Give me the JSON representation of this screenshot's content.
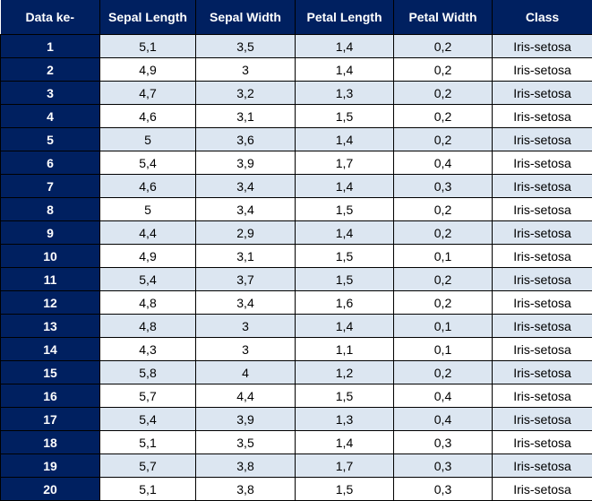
{
  "table": {
    "headers": [
      "Data ke-",
      "Sepal Length",
      "Sepal Width",
      "Petal Length",
      "Petal Width",
      "Class"
    ],
    "rows": [
      [
        "1",
        "5,1",
        "3,5",
        "1,4",
        "0,2",
        "Iris-setosa"
      ],
      [
        "2",
        "4,9",
        "3",
        "1,4",
        "0,2",
        "Iris-setosa"
      ],
      [
        "3",
        "4,7",
        "3,2",
        "1,3",
        "0,2",
        "Iris-setosa"
      ],
      [
        "4",
        "4,6",
        "3,1",
        "1,5",
        "0,2",
        "Iris-setosa"
      ],
      [
        "5",
        "5",
        "3,6",
        "1,4",
        "0,2",
        "Iris-setosa"
      ],
      [
        "6",
        "5,4",
        "3,9",
        "1,7",
        "0,4",
        "Iris-setosa"
      ],
      [
        "7",
        "4,6",
        "3,4",
        "1,4",
        "0,3",
        "Iris-setosa"
      ],
      [
        "8",
        "5",
        "3,4",
        "1,5",
        "0,2",
        "Iris-setosa"
      ],
      [
        "9",
        "4,4",
        "2,9",
        "1,4",
        "0,2",
        "Iris-setosa"
      ],
      [
        "10",
        "4,9",
        "3,1",
        "1,5",
        "0,1",
        "Iris-setosa"
      ],
      [
        "11",
        "5,4",
        "3,7",
        "1,5",
        "0,2",
        "Iris-setosa"
      ],
      [
        "12",
        "4,8",
        "3,4",
        "1,6",
        "0,2",
        "Iris-setosa"
      ],
      [
        "13",
        "4,8",
        "3",
        "1,4",
        "0,1",
        "Iris-setosa"
      ],
      [
        "14",
        "4,3",
        "3",
        "1,1",
        "0,1",
        "Iris-setosa"
      ],
      [
        "15",
        "5,8",
        "4",
        "1,2",
        "0,2",
        "Iris-setosa"
      ],
      [
        "16",
        "5,7",
        "4,4",
        "1,5",
        "0,4",
        "Iris-setosa"
      ],
      [
        "17",
        "5,4",
        "3,9",
        "1,3",
        "0,4",
        "Iris-setosa"
      ],
      [
        "18",
        "5,1",
        "3,5",
        "1,4",
        "0,3",
        "Iris-setosa"
      ],
      [
        "19",
        "5,7",
        "3,8",
        "1,7",
        "0,3",
        "Iris-setosa"
      ],
      [
        "20",
        "5,1",
        "3,8",
        "1,5",
        "0,3",
        "Iris-setosa"
      ]
    ]
  },
  "colors": {
    "header_bg": "#002060",
    "header_text": "#ffffff",
    "band_fill": "#dce6f1",
    "row_fill": "#ffffff",
    "border": "#000000"
  }
}
